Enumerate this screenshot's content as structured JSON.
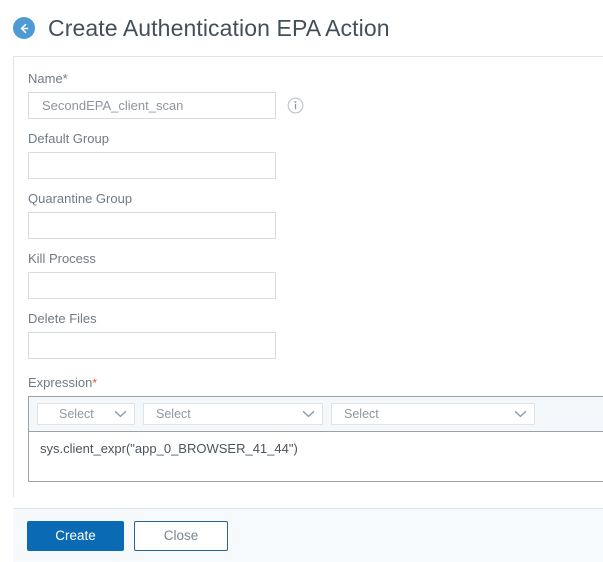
{
  "header": {
    "back_icon": "back-arrow-icon",
    "title": "Create Authentication EPA Action"
  },
  "form": {
    "name": {
      "label": "Name*",
      "value": "SecondEPA_client_scan",
      "placeholder": "",
      "info_icon": "info-icon"
    },
    "default_group": {
      "label": "Default Group",
      "value": "",
      "placeholder": ""
    },
    "quarantine_group": {
      "label": "Quarantine Group",
      "value": "",
      "placeholder": ""
    },
    "kill_process": {
      "label": "Kill Process",
      "value": "",
      "placeholder": ""
    },
    "delete_files": {
      "label": "Delete Files",
      "value": "",
      "placeholder": ""
    },
    "expression": {
      "label": "Expression",
      "required_marker": "*",
      "selects": [
        {
          "value": "Select",
          "icon": "chevron-down-icon"
        },
        {
          "value": "Select",
          "icon": "chevron-down-icon"
        },
        {
          "value": "Select",
          "icon": "chevron-down-icon"
        }
      ],
      "text": "sys.client_expr(\"app_0_BROWSER_41_44\")"
    }
  },
  "footer": {
    "create_label": "Create",
    "close_label": "Close"
  },
  "colors": {
    "accent_blue": "#0a6ab4",
    "back_icon_blue": "#4e9ad4",
    "required_orange": "#e2571e",
    "title_text": "#43505c",
    "label_text": "#6e7b87",
    "toolbar_bg": "#f4f8fb",
    "footer_bg": "#f7fafc"
  }
}
